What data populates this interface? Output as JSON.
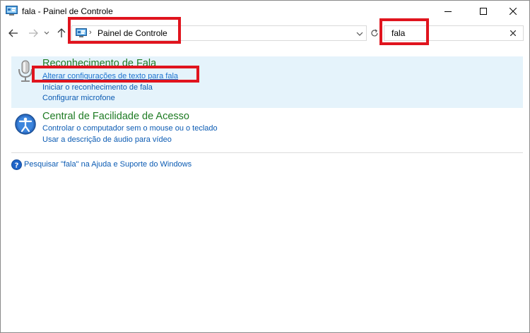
{
  "window": {
    "title": "fala - Painel de Controle"
  },
  "nav": {
    "address": "Painel de Controle",
    "address_separator": "›",
    "search_value": "fala"
  },
  "groups": [
    {
      "title": "Reconhecimento de Fala",
      "icon": "microphone-icon",
      "tasks": [
        "Alterar configurações de texto para fala",
        "Iniciar o reconhecimento de fala",
        "Configurar microfone"
      ]
    },
    {
      "title": "Central de Facilidade de Acesso",
      "icon": "ease-of-access-icon",
      "tasks": [
        "Controlar o computador sem o mouse ou o teclado",
        "Usar a descrição de áudio para vídeo"
      ]
    }
  ],
  "help": {
    "text": "Pesquisar \"fala\" na Ajuda e Suporte do Windows",
    "icon": "help-icon"
  },
  "colors": {
    "accent_highlight": "#e0141e",
    "group_title": "#1e7b23",
    "link": "#0b5bb3",
    "selected_row": "#e5f3fb"
  }
}
